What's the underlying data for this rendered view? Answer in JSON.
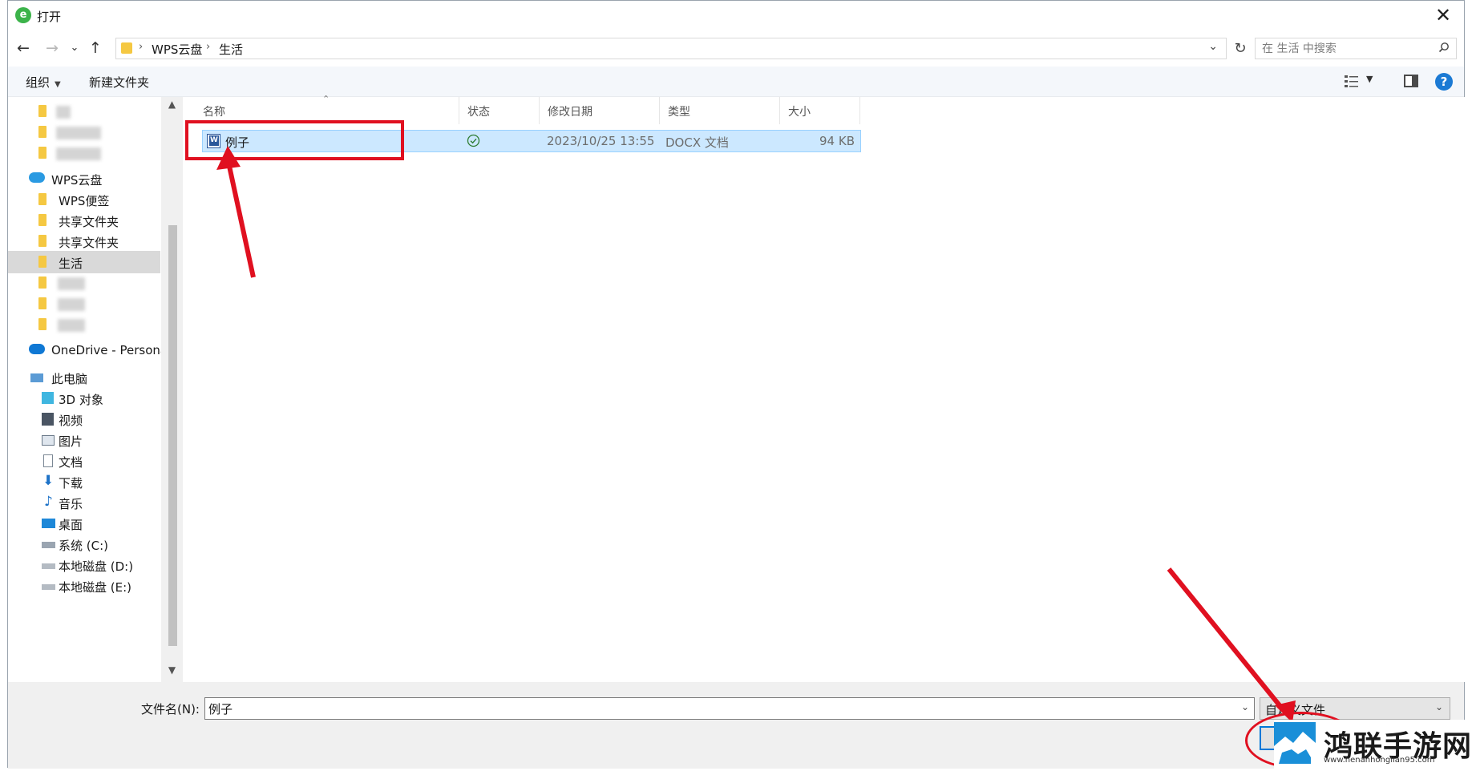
{
  "window": {
    "title": "打开",
    "app_icon_glyph": "e",
    "close_glyph": "✕"
  },
  "nav": {
    "back_glyph": "←",
    "forward_glyph": "→",
    "recent_glyph": "⌄",
    "up_glyph": "↑",
    "refresh_glyph": "↻",
    "breadcrumb": [
      "WPS云盘",
      "生活"
    ],
    "breadcrumb_sep": "›",
    "search_placeholder": "在 生活 中搜索"
  },
  "toolbar": {
    "organize_label": "组织",
    "new_folder_label": "新建文件夹",
    "help_glyph": "?"
  },
  "sidebar": {
    "items": [
      {
        "label": "WPS云盘",
        "icon": "cloud-icon"
      },
      {
        "label": "WPS便签",
        "icon": "folder-icon"
      },
      {
        "label": "共享文件夹",
        "icon": "shared-folder-icon"
      },
      {
        "label": "共享文件夹",
        "icon": "shared-folder-icon"
      },
      {
        "label": "生活",
        "icon": "folder-icon",
        "selected": true
      },
      {
        "label": "OneDrive - Persona",
        "icon": "onedrive-icon"
      },
      {
        "label": "此电脑",
        "icon": "computer-icon"
      },
      {
        "label": "3D 对象",
        "icon": "3d-objects-icon"
      },
      {
        "label": "视频",
        "icon": "video-icon"
      },
      {
        "label": "图片",
        "icon": "pictures-icon"
      },
      {
        "label": "文档",
        "icon": "documents-icon"
      },
      {
        "label": "下载",
        "icon": "downloads-icon"
      },
      {
        "label": "音乐",
        "icon": "music-icon"
      },
      {
        "label": "桌面",
        "icon": "desktop-icon"
      },
      {
        "label": "系统 (C:)",
        "icon": "system-drive-icon"
      },
      {
        "label": "本地磁盘 (D:)",
        "icon": "drive-icon"
      },
      {
        "label": "本地磁盘 (E:)",
        "icon": "drive-icon"
      }
    ]
  },
  "filelist": {
    "columns": [
      "名称",
      "状态",
      "修改日期",
      "类型",
      "大小"
    ],
    "rows": [
      {
        "name": "例子",
        "status": "synced",
        "modified": "2023/10/25 13:55",
        "type": "DOCX 文档",
        "size": "94 KB"
      }
    ]
  },
  "footer": {
    "filename_label": "文件名(N):",
    "filename_value": "例子",
    "filter_label": "自定义文件"
  },
  "watermark": {
    "title": "鸿联手游网",
    "url": "www.henanhonglian95.com"
  },
  "colors": {
    "accent": "#0078d7",
    "selection_bg": "#cce8ff",
    "annotation_red": "#e01020",
    "folder_yellow": "#f5c842"
  }
}
